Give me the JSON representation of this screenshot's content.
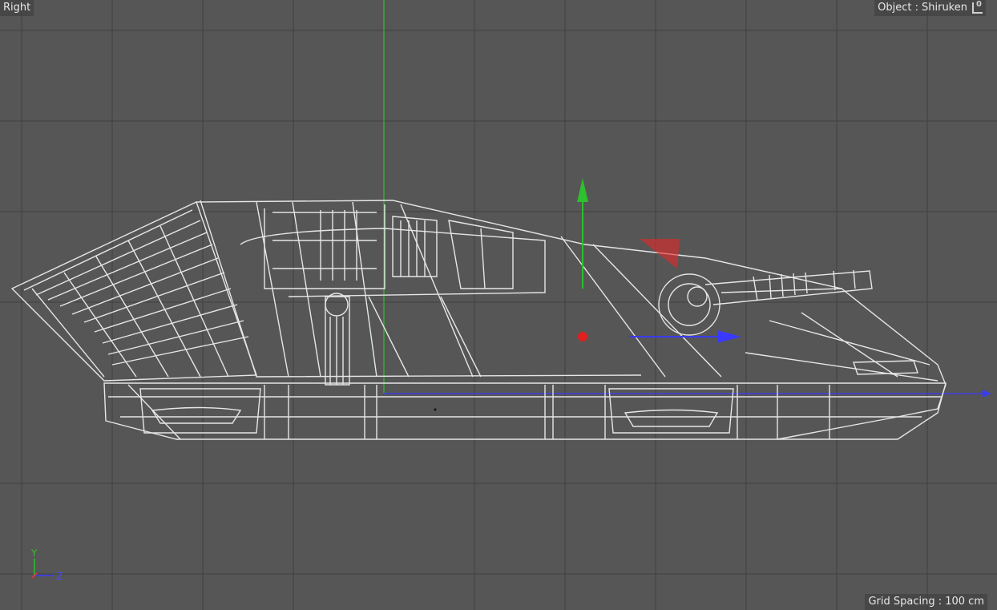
{
  "viewport": {
    "view_name": "Right",
    "object_prefix": "Object : ",
    "object_name": "Shiruken",
    "lock_badge": "0",
    "grid_spacing": "Grid Spacing : 100 cm"
  },
  "axis_gizmo": {
    "y_label": "Y",
    "z_label": "Z"
  },
  "colors": {
    "background": "#565656",
    "grid_line": "#3f3f3f",
    "wireframe": "#e6e6e6",
    "y_axis": "#2fbf2f",
    "z_axis": "#3a3aff",
    "x_axis": "#ff3030"
  }
}
